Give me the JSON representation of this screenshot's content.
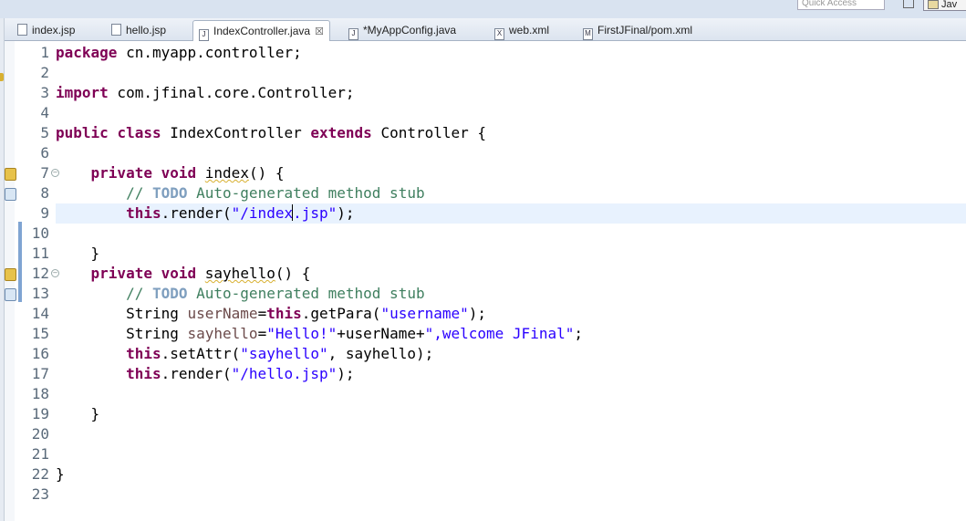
{
  "toolbar": {
    "quick_access_placeholder": "Quick Access",
    "perspective_label": "Jav"
  },
  "tabs": [
    {
      "label": "index.jsp",
      "icon": "jsp-file-icon",
      "active": false
    },
    {
      "label": "hello.jsp",
      "icon": "jsp-file-icon",
      "active": false
    },
    {
      "label": "IndexController.java",
      "icon": "java-file-icon",
      "active": true,
      "close": "☒"
    },
    {
      "label": "*MyAppConfig.java",
      "icon": "java-file-icon",
      "active": false
    },
    {
      "label": "web.xml",
      "icon": "xml-file-icon",
      "active": false
    },
    {
      "label": "FirstJFinal/pom.xml",
      "icon": "maven-pom-icon",
      "active": false
    }
  ],
  "editor": {
    "line_numbers": [
      "1",
      "2",
      "3",
      "4",
      "5",
      "6",
      "7",
      "8",
      "9",
      "10",
      "11",
      "12",
      "13",
      "14",
      "15",
      "16",
      "17",
      "18",
      "19",
      "20",
      "21",
      "22",
      "23"
    ],
    "lines": {
      "l1": [
        "package",
        " cn.myapp.controller;"
      ],
      "l3": [
        "import",
        " com.jfinal.core.Controller;"
      ],
      "l5": [
        "public",
        " ",
        "class",
        " IndexController ",
        "extends",
        " Controller {"
      ],
      "l7": [
        "    ",
        "private",
        " ",
        "void",
        " ",
        "index",
        "() {"
      ],
      "l8": [
        "        // ",
        "TODO",
        " Auto-generated method stub"
      ],
      "l9": [
        "        ",
        "this",
        ".render(",
        "\"/index",
        ".jsp\"",
        ");"
      ],
      "l11": [
        "    }"
      ],
      "l12": [
        "    ",
        "private",
        " ",
        "void",
        " ",
        "sayhello",
        "() {"
      ],
      "l13": [
        "        // ",
        "TODO",
        " Auto-generated method stub"
      ],
      "l14": [
        "        String ",
        "userName",
        "=",
        "this",
        ".getPara(",
        "\"username\"",
        ");"
      ],
      "l15": [
        "        String ",
        "sayhello",
        "=",
        "\"Hello!\"",
        "+userName+",
        "\",welcome JFinal\"",
        ";"
      ],
      "l16": [
        "        ",
        "this",
        ".setAttr(",
        "\"sayhello\"",
        ", sayhello);"
      ],
      "l17": [
        "        ",
        "this",
        ".render(",
        "\"/hello.jsp\"",
        ");"
      ],
      "l19": [
        "    }"
      ],
      "l22": [
        "}"
      ]
    }
  },
  "colors": {
    "keyword": "#7f0055",
    "string": "#2a00ff",
    "comment": "#3f7f5f",
    "todo": "#7f9fbf",
    "current_line": "#e8f2fe"
  }
}
